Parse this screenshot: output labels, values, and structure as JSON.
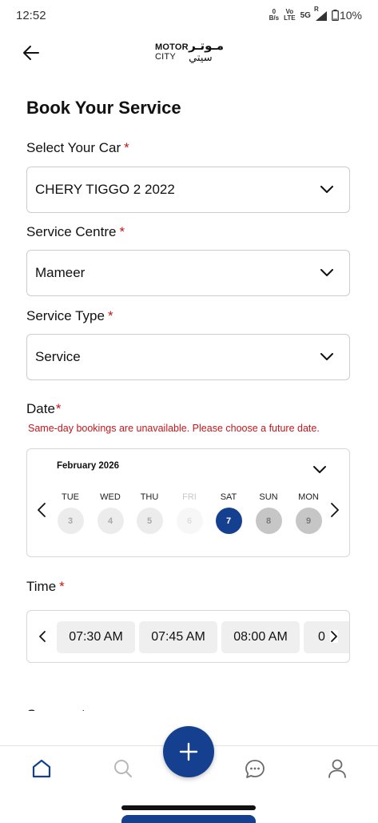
{
  "status_bar": {
    "time": "12:52",
    "data_rate_top": "0",
    "data_rate_bottom": "B/s",
    "volte_top": "Vo",
    "volte_bottom": "LTE",
    "network": "5G",
    "roaming": "R",
    "battery": "10%"
  },
  "header": {
    "back_icon": "arrow-left-icon",
    "logo_en_line1": "MOTOR",
    "logo_en_line2": "CITY",
    "logo_ar_line1": "مـوتـر",
    "logo_ar_line2": "سيتي"
  },
  "page_title": "Book Your Service",
  "form": {
    "car": {
      "label": "Select Your Car",
      "required": "*",
      "value": "CHERY TIGGO 2 2022"
    },
    "centre": {
      "label": "Service Centre",
      "required": "*",
      "value": "Mameer"
    },
    "type": {
      "label": "Service Type",
      "required": "*",
      "value": "Service"
    },
    "date": {
      "label": "Date",
      "required": "*",
      "error": "Same-day bookings are unavailable. Please choose a future date."
    },
    "time": {
      "label": "Time",
      "required": "*"
    },
    "comment": {
      "label": "Comment"
    }
  },
  "calendar": {
    "month": "February 2026",
    "days": [
      {
        "name": "TUE",
        "num": "3",
        "state": "normal"
      },
      {
        "name": "WED",
        "num": "4",
        "state": "normal"
      },
      {
        "name": "THU",
        "num": "5",
        "state": "normal"
      },
      {
        "name": "FRI",
        "num": "6",
        "state": "disabled"
      },
      {
        "name": "SAT",
        "num": "7",
        "state": "selected"
      },
      {
        "name": "SUN",
        "num": "8",
        "state": "dark"
      },
      {
        "name": "MON",
        "num": "9",
        "state": "dark"
      }
    ]
  },
  "time_slots": [
    "07:30 AM",
    "07:45 AM",
    "08:00 AM",
    "0"
  ],
  "nav": {
    "items": [
      "home-icon",
      "search-icon",
      "add-icon",
      "chat-icon",
      "profile-icon"
    ]
  },
  "colors": {
    "primary": "#15408f",
    "required": "#c4161c",
    "border": "#c9ccd1"
  }
}
